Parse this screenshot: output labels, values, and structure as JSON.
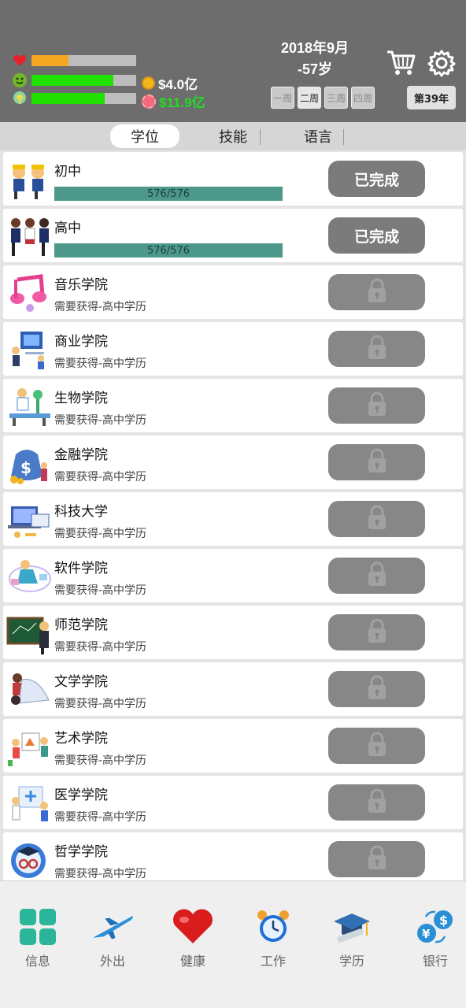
{
  "status": {
    "health_fill": 0.35,
    "happy_fill": 0.78,
    "smart_fill": 0.7,
    "money": "$4.0亿",
    "assets": "$11.9亿"
  },
  "date": {
    "line1": "2018年9月",
    "line2": "-57岁"
  },
  "weeks": [
    "一周",
    "二周",
    "三周",
    "四周"
  ],
  "active_week": 1,
  "year_button": "第39年",
  "tabs": [
    "学位",
    "技能",
    "语言"
  ],
  "active_tab": 0,
  "schools": [
    {
      "name": "初中",
      "status": "已完成",
      "progress_text": "576/576",
      "completed": true
    },
    {
      "name": "高中",
      "status": "已完成",
      "progress_text": "576/576",
      "completed": true
    },
    {
      "name": "音乐学院",
      "requirement": "需要获得-高中学历",
      "completed": false
    },
    {
      "name": "商业学院",
      "requirement": "需要获得-高中学历",
      "completed": false
    },
    {
      "name": "生物学院",
      "requirement": "需要获得-高中学历",
      "completed": false
    },
    {
      "name": "金融学院",
      "requirement": "需要获得-高中学历",
      "completed": false
    },
    {
      "name": "科技大学",
      "requirement": "需要获得-高中学历",
      "completed": false
    },
    {
      "name": "软件学院",
      "requirement": "需要获得-高中学历",
      "completed": false
    },
    {
      "name": "师范学院",
      "requirement": "需要获得-高中学历",
      "completed": false
    },
    {
      "name": "文学学院",
      "requirement": "需要获得-高中学历",
      "completed": false
    },
    {
      "name": "艺术学院",
      "requirement": "需要获得-高中学历",
      "completed": false
    },
    {
      "name": "医学学院",
      "requirement": "需要获得-高中学历",
      "completed": false
    },
    {
      "name": "哲学学院",
      "requirement": "需要获得-高中学历",
      "completed": false
    }
  ],
  "nav": [
    {
      "label": "信息",
      "icon": "info-grid-icon"
    },
    {
      "label": "外出",
      "icon": "airplane-icon"
    },
    {
      "label": "健康",
      "icon": "heart-icon"
    },
    {
      "label": "工作",
      "icon": "alarm-clock-icon"
    },
    {
      "label": "学历",
      "icon": "graduation-cap-icon"
    },
    {
      "label": "银行",
      "icon": "currency-exchange-icon"
    }
  ],
  "colors": {
    "header_bg": "#6d6d6d",
    "health_bar": "#f5a623",
    "green_bar": "#22e000",
    "progress_bar": "#4c988b",
    "button_gray": "#7b7b7b",
    "assets_green": "#22dd22"
  }
}
